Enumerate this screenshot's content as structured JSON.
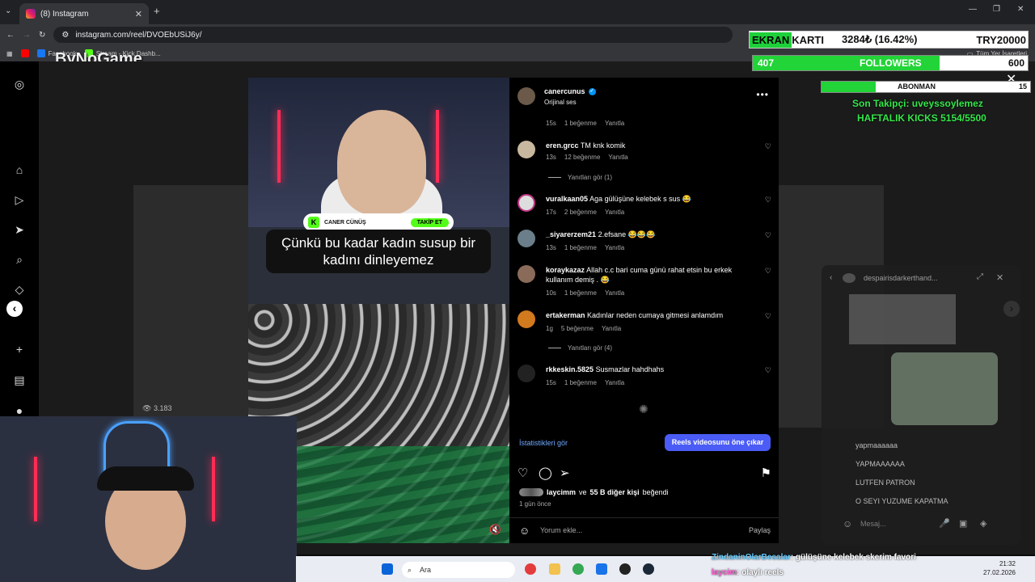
{
  "browser": {
    "tab_title": "(8) Instagram",
    "url": "instagram.com/reel/DVOEbUSiJ6y/",
    "bookmarks": [
      "Facebook",
      "Stream - Kick Dashb..."
    ],
    "all_bookmarks": "Tüm Yer İşaretleri",
    "logo_text": "ByNoGame"
  },
  "reel": {
    "promo_name": "CANER CÜNÜŞ",
    "promo_button": "TAKİP ET",
    "caption": "Çünkü bu kadar kadın susup bir kadını dinleyemez",
    "bg_views": "3.183"
  },
  "post": {
    "author": "canercunus",
    "audio": "Orijinal ses",
    "header_meta": {
      "time": "15s",
      "likes": "1 beğenme",
      "reply": "Yanıtla"
    },
    "comments": [
      {
        "user": "eren.grcc",
        "text": "TM knk komik",
        "time": "13s",
        "likes": "12 beğenme",
        "reply": "Yanıtla",
        "av": "#c9b8a0",
        "replies": "Yanıtları gör (1)"
      },
      {
        "user": "vuralkaan05",
        "text": "Aga gülüşüne kelebek s sus 😂",
        "time": "17s",
        "likes": "2 beğenme",
        "reply": "Yanıtla",
        "av": "#ddd"
      },
      {
        "user": "_siyarerzem21",
        "text": "2.efsane 😂😂😂",
        "time": "13s",
        "likes": "1 beğenme",
        "reply": "Yanıtla",
        "av": "#6b7f8a"
      },
      {
        "user": "koraykazaz",
        "text": "Allah c.c bari cuma günü rahat etsin bu erkek kullanım demiş . 😂",
        "time": "10s",
        "likes": "1 beğenme",
        "reply": "Yanıtla",
        "av": "#8a6b5a"
      },
      {
        "user": "ertakerman",
        "text": "Kadınlar neden cumaya gitmesi anlamdım",
        "time": "1g",
        "likes": "5 beğenme",
        "reply": "Yanıtla",
        "av": "#d17a1e",
        "replies": "Yanıtları gör (4)"
      },
      {
        "user": "rkkeskin.5825",
        "text": "Susmazlar hahdhahs",
        "time": "15s",
        "likes": "1 beğenme",
        "reply": "Yanıtla",
        "av": "#222"
      }
    ],
    "stats_link": "İstatistikleri gör",
    "boost_button": "Reels videosunu öne çıkar",
    "liked_by_user": "laycimm",
    "liked_by_rest": "ve",
    "liked_by_count": "55 B diğer kişi",
    "liked_by_tail": "beğendi",
    "ago": "1 gün önce",
    "comment_placeholder": "Yorum ekle...",
    "share_label": "Paylaş"
  },
  "overlay": {
    "ekran_label": "EKRAN",
    "karti_label": "KARTI",
    "price": "3284₺ (16.42%)",
    "goal": "TRY20000",
    "followers_current": "407",
    "followers_label": "FOLLOWERS",
    "followers_goal": "600",
    "followers_progress": 0.678,
    "abonman_label": "ABONMAN",
    "abonman_goal": "15",
    "abonman_progress": 0.26,
    "last_follower": "Son Takipçi: uveyssoylemez",
    "weekly": "HAFTALIK KICKS 5154/5500",
    "accent_green": "#34e64a"
  },
  "dm": {
    "title": "despairisdarkerthand...",
    "messages": [
      "yapmaaaaaa",
      "YAPMAAAAAA",
      "LUTFEN PATRON",
      "O SEYI YUZUME KAPATMA"
    ],
    "input_placeholder": "Mesaj..."
  },
  "chat": [
    {
      "user": "ZindaninOlarBesalar",
      "msg": ": gülüşüne kelebek skerim favori"
    },
    {
      "user": "laycim",
      "msg": ": olaylı reels"
    }
  ],
  "taskbar": {
    "search": "Ara",
    "time": "21:32",
    "date": "27.02.2026"
  }
}
